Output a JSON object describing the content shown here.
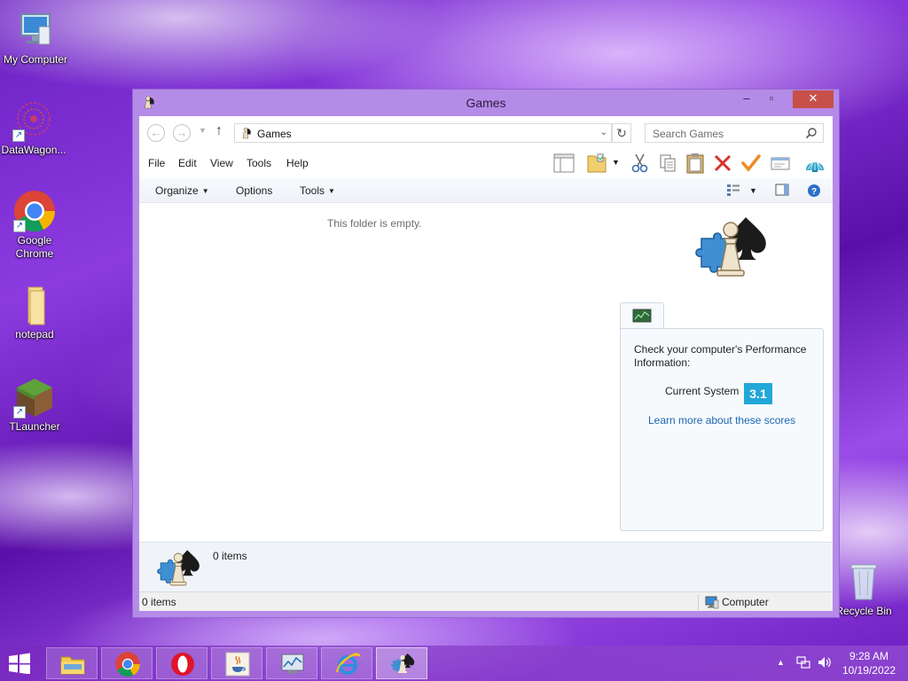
{
  "desktop": {
    "icons": [
      {
        "label": "My Computer"
      },
      {
        "label": "DataWagon..."
      },
      {
        "label": "Google Chrome"
      },
      {
        "label": "notepad"
      },
      {
        "label": "TLauncher"
      },
      {
        "label": "Recycle Bin"
      }
    ]
  },
  "window": {
    "title": "Games",
    "address": "Games",
    "search_placeholder": "Search Games",
    "menu": [
      "File",
      "Edit",
      "View",
      "Tools",
      "Help"
    ],
    "commands": {
      "organize": "Organize",
      "options": "Options",
      "tools": "Tools"
    },
    "empty_message": "This folder is empty.",
    "performance": {
      "intro": "Check your computer's Performance Information:",
      "label": "Current System",
      "score": "3.1",
      "link": "Learn more about these scores"
    },
    "details_count": "0 items",
    "status_left": "0 items",
    "status_right": "Computer"
  },
  "taskbar": {
    "apps": [
      "file-explorer",
      "chrome",
      "opera",
      "java",
      "performance-monitor",
      "internet-explorer",
      "games"
    ],
    "active_app": "games",
    "time": "9:28 AM",
    "date": "10/19/2022"
  },
  "colors": {
    "accent": "#b58be8",
    "close": "#c7504a",
    "score": "#22a7d9",
    "link": "#1a66b3"
  }
}
